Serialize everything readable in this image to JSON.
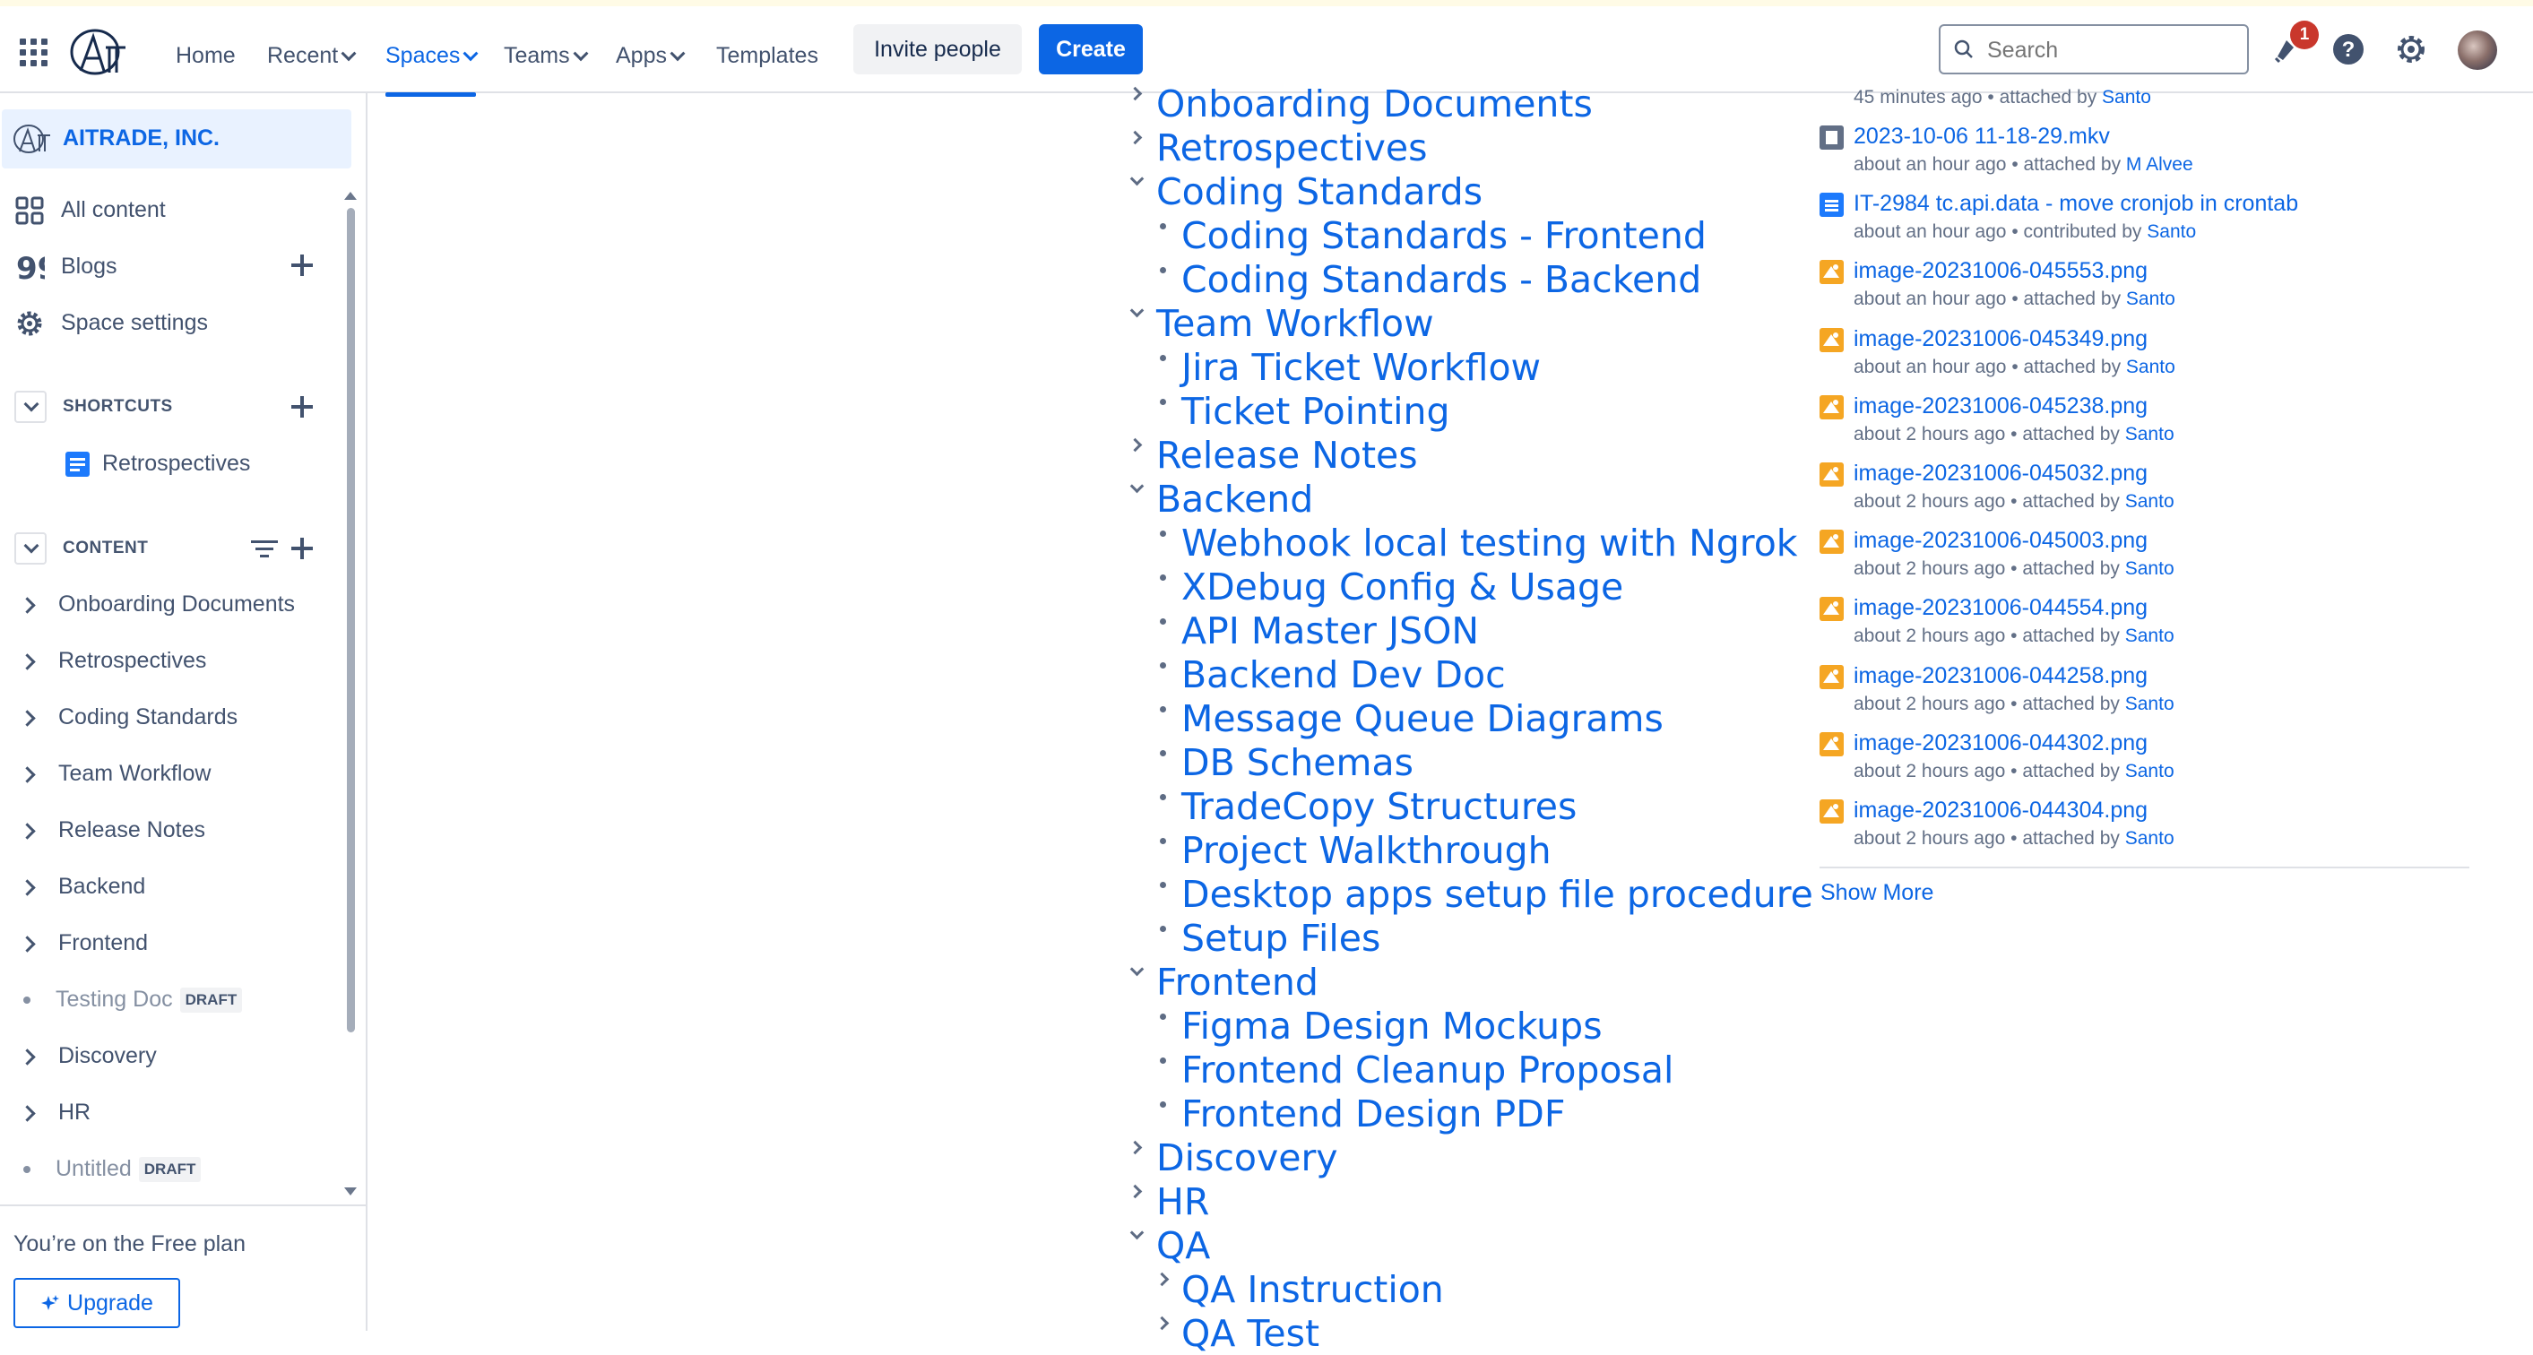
{
  "nav": {
    "home": "Home",
    "recent": "Recent",
    "spaces": "Spaces",
    "teams": "Teams",
    "apps": "Apps",
    "templates": "Templates",
    "invite": "Invite people",
    "create": "Create",
    "search_placeholder": "Search",
    "notification_count": "1",
    "icons": [
      "app-switcher-icon",
      "logo",
      "notifications-icon",
      "help-icon",
      "settings-icon",
      "avatar"
    ]
  },
  "sidebar": {
    "space_name": "AITRADE, INC.",
    "items": [
      {
        "label": "All content",
        "icon": "grid-icon"
      },
      {
        "label": "Blogs",
        "icon": "quote-icon"
      },
      {
        "label": "Space settings",
        "icon": "gear-icon"
      }
    ],
    "shortcuts_heading": "SHORTCUTS",
    "shortcut_item": "Retrospectives",
    "content_heading": "CONTENT",
    "tree": [
      {
        "label": "Onboarding Documents",
        "type": "folder"
      },
      {
        "label": "Retrospectives",
        "type": "folder"
      },
      {
        "label": "Coding Standards",
        "type": "folder"
      },
      {
        "label": "Team Workflow",
        "type": "folder"
      },
      {
        "label": "Release Notes",
        "type": "folder"
      },
      {
        "label": "Backend",
        "type": "folder"
      },
      {
        "label": "Frontend",
        "type": "folder"
      },
      {
        "label": "Testing Doc",
        "type": "draft",
        "badge": "DRAFT"
      },
      {
        "label": "Discovery",
        "type": "folder"
      },
      {
        "label": "HR",
        "type": "folder"
      },
      {
        "label": "Untitled",
        "type": "draft",
        "badge": "DRAFT"
      }
    ],
    "free_plan": "You’re on the Free plan",
    "upgrade": "Upgrade"
  },
  "main_tree": [
    {
      "label": "Onboarding Documents",
      "level": 0,
      "marker": "collapsed"
    },
    {
      "label": "Retrospectives",
      "level": 0,
      "marker": "collapsed"
    },
    {
      "label": "Coding Standards",
      "level": 0,
      "marker": "expanded"
    },
    {
      "label": "Coding Standards - Frontend",
      "level": 1,
      "marker": "bullet"
    },
    {
      "label": "Coding Standards - Backend",
      "level": 1,
      "marker": "bullet"
    },
    {
      "label": "Team Workflow",
      "level": 0,
      "marker": "expanded"
    },
    {
      "label": "Jira Ticket Workflow",
      "level": 1,
      "marker": "bullet"
    },
    {
      "label": "Ticket Pointing",
      "level": 1,
      "marker": "bullet"
    },
    {
      "label": "Release Notes",
      "level": 0,
      "marker": "collapsed"
    },
    {
      "label": "Backend",
      "level": 0,
      "marker": "expanded"
    },
    {
      "label": "Webhook local testing with Ngrok",
      "level": 1,
      "marker": "bullet"
    },
    {
      "label": "XDebug Config & Usage",
      "level": 1,
      "marker": "bullet"
    },
    {
      "label": "API Master JSON",
      "level": 1,
      "marker": "bullet"
    },
    {
      "label": "Backend Dev Doc",
      "level": 1,
      "marker": "bullet"
    },
    {
      "label": "Message Queue Diagrams",
      "level": 1,
      "marker": "bullet"
    },
    {
      "label": "DB Schemas",
      "level": 1,
      "marker": "bullet"
    },
    {
      "label": "TradeCopy Structures",
      "level": 1,
      "marker": "bullet"
    },
    {
      "label": "Project Walkthrough",
      "level": 1,
      "marker": "bullet"
    },
    {
      "label": "Desktop apps setup file procedure",
      "level": 1,
      "marker": "bullet"
    },
    {
      "label": "Setup Files",
      "level": 1,
      "marker": "bullet"
    },
    {
      "label": "Frontend",
      "level": 0,
      "marker": "expanded"
    },
    {
      "label": "Figma Design Mockups",
      "level": 1,
      "marker": "bullet"
    },
    {
      "label": "Frontend Cleanup Proposal",
      "level": 1,
      "marker": "bullet"
    },
    {
      "label": "Frontend Design PDF",
      "level": 1,
      "marker": "bullet"
    },
    {
      "label": "Discovery",
      "level": 0,
      "marker": "collapsed"
    },
    {
      "label": "HR",
      "level": 0,
      "marker": "collapsed"
    },
    {
      "label": "QA",
      "level": 0,
      "marker": "expanded"
    },
    {
      "label": "QA Instruction",
      "level": 1,
      "marker": "collapsed"
    },
    {
      "label": "QA Test",
      "level": 1,
      "marker": "collapsed"
    }
  ],
  "activity": {
    "top_meta": {
      "text": "45 minutes ago • attached by ",
      "who": "Santo"
    },
    "items": [
      {
        "title": "2023-10-06 11-18-29.mkv",
        "meta": "about an hour ago • attached by ",
        "who": "M Alvee",
        "icon": "file"
      },
      {
        "title": "IT-2984 tc.api.data - move cronjob in crontab",
        "meta": "about an hour ago • contributed by ",
        "who": "Santo",
        "icon": "page"
      },
      {
        "title": "image-20231006-045553.png",
        "meta": "about an hour ago • attached by ",
        "who": "Santo",
        "icon": "img"
      },
      {
        "title": "image-20231006-045349.png",
        "meta": "about an hour ago • attached by ",
        "who": "Santo",
        "icon": "img"
      },
      {
        "title": "image-20231006-045238.png",
        "meta": "about 2 hours ago • attached by ",
        "who": "Santo",
        "icon": "img"
      },
      {
        "title": "image-20231006-045032.png",
        "meta": "about 2 hours ago • attached by ",
        "who": "Santo",
        "icon": "img"
      },
      {
        "title": "image-20231006-045003.png",
        "meta": "about 2 hours ago • attached by ",
        "who": "Santo",
        "icon": "img"
      },
      {
        "title": "image-20231006-044554.png",
        "meta": "about 2 hours ago • attached by ",
        "who": "Santo",
        "icon": "img"
      },
      {
        "title": "image-20231006-044258.png",
        "meta": "about 2 hours ago • attached by ",
        "who": "Santo",
        "icon": "img"
      },
      {
        "title": "image-20231006-044302.png",
        "meta": "about 2 hours ago • attached by ",
        "who": "Santo",
        "icon": "img"
      },
      {
        "title": "image-20231006-044304.png",
        "meta": "about 2 hours ago • attached by ",
        "who": "Santo",
        "icon": "img"
      }
    ],
    "show_more": "Show More"
  }
}
